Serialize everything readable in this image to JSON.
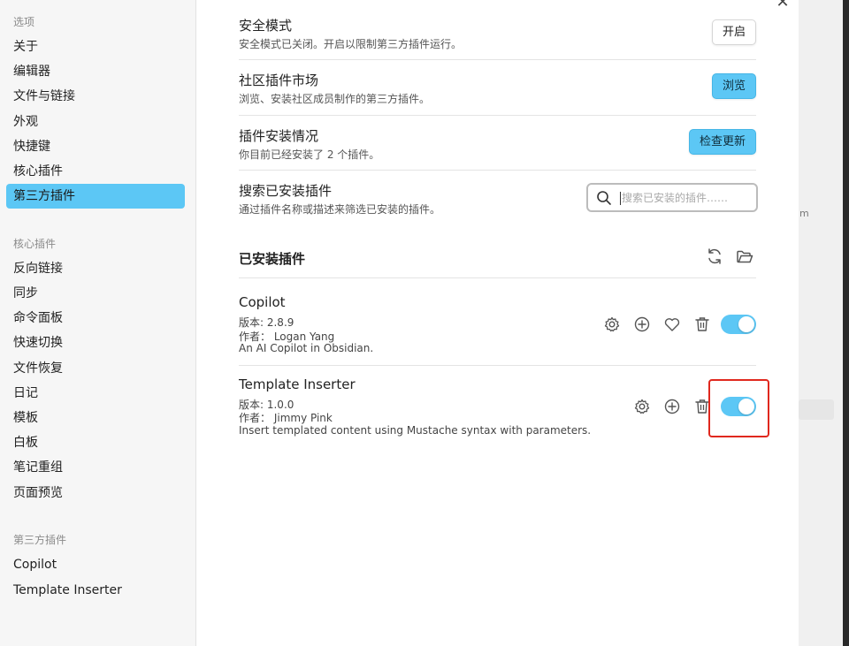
{
  "sidebar": {
    "options_heading": "选项",
    "options_items": [
      "关于",
      "编辑器",
      "文件与链接",
      "外观",
      "快捷键",
      "核心插件",
      "第三方插件"
    ],
    "core_heading": "核心插件",
    "core_items": [
      "反向链接",
      "同步",
      "命令面板",
      "快速切换",
      "文件恢复",
      "日记",
      "模板",
      "白板",
      "笔记重组",
      "页面预览"
    ],
    "third_heading": "第三方插件",
    "third_items": [
      "Copilot",
      "Template Inserter"
    ]
  },
  "settings": {
    "safe_mode": {
      "name": "安全模式",
      "desc": "安全模式已关闭。开启以限制第三方插件运行。",
      "button": "开启"
    },
    "community": {
      "name": "社区插件市场",
      "desc": "浏览、安装社区成员制作的第三方插件。",
      "button": "浏览"
    },
    "installed_status": {
      "name": "插件安装情况",
      "desc": "你目前已经安装了 2 个插件。",
      "button": "检查更新"
    },
    "search_installed": {
      "name": "搜索已安装插件",
      "desc": "通过插件名称或描述来筛选已安装的插件。",
      "placeholder": "搜索已安装的插件……"
    }
  },
  "installed": {
    "title": "已安装插件",
    "plugins": [
      {
        "name": "Copilot",
        "version": "版本: 2.8.9",
        "author": "作者： Logan Yang",
        "description": "An AI Copilot in Obsidian.",
        "enabled": true
      },
      {
        "name": "Template Inserter",
        "version": "版本: 1.0.0",
        "author": "作者： Jimmy Pink",
        "description": "Insert templated content using Mustache syntax with parameters.",
        "enabled": true
      }
    ]
  },
  "colors": {
    "accent": "#5cc7f5",
    "highlight": "#e0281e"
  },
  "icons": [
    "close-icon",
    "search-icon",
    "refresh-icon",
    "folder-icon",
    "gear-icon",
    "plus-circle-icon",
    "heart-icon",
    "trash-icon"
  ]
}
